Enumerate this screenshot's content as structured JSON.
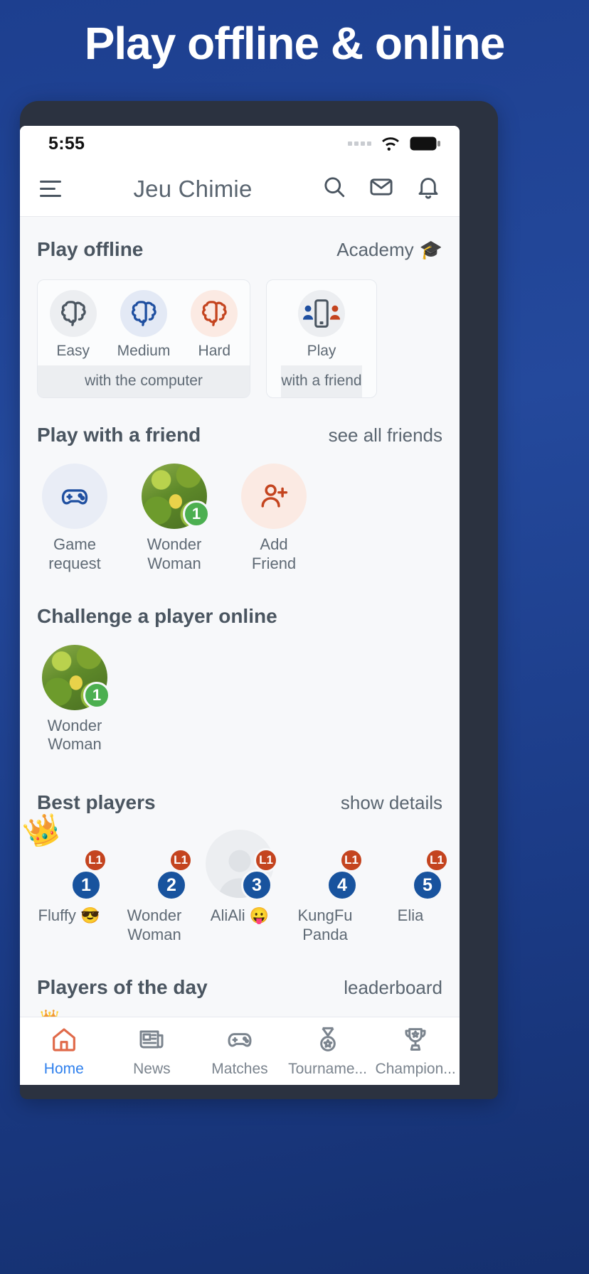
{
  "promo": {
    "headline": "Play offline & online"
  },
  "status_bar": {
    "time": "5:55",
    "signal_icon": "signal-dots-icon",
    "wifi_icon": "wifi-icon",
    "battery_icon": "battery-full-icon"
  },
  "app_bar": {
    "menu_icon": "hamburger-menu-icon",
    "title": "Jeu Chimie",
    "search_icon": "search-icon",
    "mail_icon": "mail-icon",
    "bell_icon": "bell-icon"
  },
  "play_offline": {
    "title": "Play offline",
    "academy_label": "Academy",
    "academy_icon": "graduation-cap-icon",
    "computer_card": {
      "footer": "with the computer",
      "options": [
        {
          "label": "Easy",
          "icon": "brain-icon",
          "color": "#4a5560",
          "bg": "#eceef1"
        },
        {
          "label": "Medium",
          "icon": "brain-icon",
          "color": "#1f4fa0",
          "bg": "#e3e9f5"
        },
        {
          "label": "Hard",
          "icon": "brain-icon",
          "color": "#c4441f",
          "bg": "#fbeae3"
        }
      ]
    },
    "friend_card": {
      "footer": "with a friend",
      "option": {
        "label": "Play",
        "icon": "two-players-phone-icon"
      }
    }
  },
  "play_with_friend": {
    "title": "Play with a friend",
    "see_all_label": "see all friends",
    "items": [
      {
        "name": "Game\nrequest",
        "line1": "Game",
        "line2": "request",
        "icon": "gamepad-icon",
        "avatar": "icon-gamepad",
        "badge": ""
      },
      {
        "name": "Wonder Woman",
        "line1": "Wonder",
        "line2": "Woman",
        "icon": "",
        "avatar": "photo-leafy",
        "badge": "1"
      },
      {
        "name": "Add Friend",
        "line1": "Add",
        "line2": "Friend",
        "icon": "add-person-icon",
        "avatar": "icon-add-friend",
        "badge": ""
      }
    ]
  },
  "challenge_online": {
    "title": "Challenge a player online",
    "items": [
      {
        "line1": "Wonder",
        "line2": "Woman",
        "avatar": "photo-leafy",
        "badge": "1"
      }
    ]
  },
  "best_players": {
    "title": "Best players",
    "details_label": "show details",
    "items": [
      {
        "name": "Fluffy 😎",
        "line1": "Fluffy 😎",
        "line2": "",
        "avatar": "photo-collage",
        "level": "L1",
        "rank": "1",
        "crown": "👑"
      },
      {
        "name": "Wonder Woman",
        "line1": "Wonder",
        "line2": "Woman",
        "avatar": "photo-leafy",
        "level": "L1",
        "rank": "2",
        "crown": ""
      },
      {
        "name": "AliAli 😛",
        "line1": "AliAli 😛",
        "line2": "",
        "avatar": "photo-placeholder",
        "level": "L1",
        "rank": "3",
        "crown": ""
      },
      {
        "name": "KungFu Panda",
        "line1": "KungFu",
        "line2": "Panda",
        "avatar": "photo-seaside",
        "level": "L1",
        "rank": "4",
        "crown": ""
      },
      {
        "name": "Elia",
        "line1": "Elia",
        "line2": "",
        "avatar": "photo-flowers",
        "level": "L1",
        "rank": "5",
        "crown": ""
      }
    ]
  },
  "players_of_day": {
    "title": "Players of the day",
    "leaderboard_label": "leaderboard"
  },
  "bottom_nav": {
    "items": [
      {
        "label": "Home",
        "icon": "home-icon",
        "active": true
      },
      {
        "label": "News",
        "icon": "news-icon",
        "active": false
      },
      {
        "label": "Matches",
        "icon": "gamepad-icon",
        "active": false
      },
      {
        "label": "Tourname...",
        "icon": "medal-icon",
        "active": false
      },
      {
        "label": "Champion...",
        "icon": "trophy-icon",
        "active": false
      }
    ]
  },
  "colors": {
    "promo_bg": "#1d3f8f",
    "accent_blue": "#2f80ed",
    "rank_blue": "#18539e",
    "level_orange": "#c4441f",
    "badge_green": "#4caf50"
  }
}
